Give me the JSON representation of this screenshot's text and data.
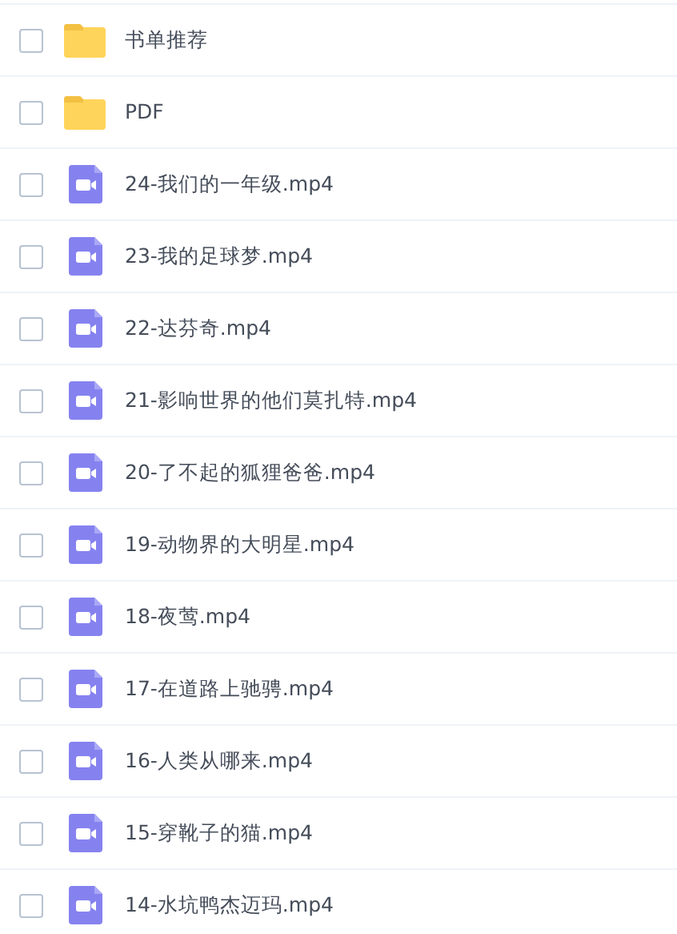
{
  "files": [
    {
      "kind": "folder",
      "name": "书单推荐",
      "checked": false
    },
    {
      "kind": "folder",
      "name": "PDF",
      "checked": false
    },
    {
      "kind": "video",
      "name": "24-我们的一年级.mp4",
      "checked": false
    },
    {
      "kind": "video",
      "name": "23-我的足球梦.mp4",
      "checked": false
    },
    {
      "kind": "video",
      "name": "22-达芬奇.mp4",
      "checked": false
    },
    {
      "kind": "video",
      "name": "21-影响世界的他们莫扎特.mp4",
      "checked": false
    },
    {
      "kind": "video",
      "name": "20-了不起的狐狸爸爸.mp4",
      "checked": false
    },
    {
      "kind": "video",
      "name": "19-动物界的大明星.mp4",
      "checked": false
    },
    {
      "kind": "video",
      "name": "18-夜莺.mp4",
      "checked": false
    },
    {
      "kind": "video",
      "name": "17-在道路上驰骋.mp4",
      "checked": false
    },
    {
      "kind": "video",
      "name": "16-人类从哪来.mp4",
      "checked": false
    },
    {
      "kind": "video",
      "name": "15-穿靴子的猫.mp4",
      "checked": false
    },
    {
      "kind": "video",
      "name": "14-水坑鸭杰迈玛.mp4",
      "checked": false
    }
  ]
}
